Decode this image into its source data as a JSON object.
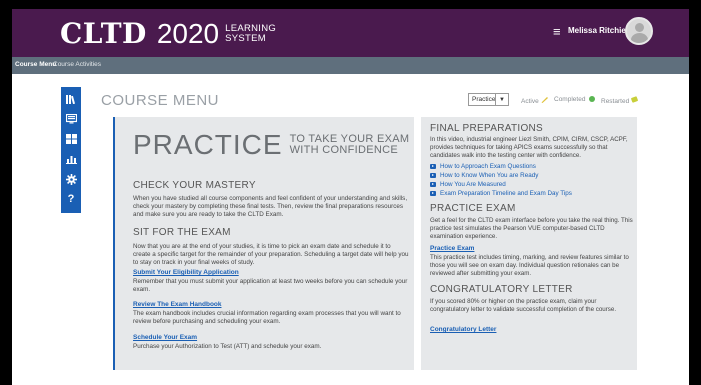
{
  "header": {
    "brand_main": "CLTD",
    "brand_year": "2020",
    "brand_sub_1": "LEARNING",
    "brand_sub_2": "SYSTEM",
    "menu_icon": "hamburger-icon",
    "user_name": "Melissa Ritchie"
  },
  "subnav": {
    "items": [
      "Course Menu",
      "Course Activities"
    ]
  },
  "rail": {
    "icons": [
      "book-icon",
      "monitor-icon",
      "grid-icon",
      "bar-chart-icon",
      "gear-icon",
      "help-icon"
    ],
    "help_glyph": "?"
  },
  "toolbar": {
    "title": "COURSE MENU",
    "view_selected": "Practice",
    "legend": {
      "active": "Active",
      "completed": "Completed",
      "restarted": "Restarted"
    }
  },
  "colors": {
    "header_bg": "#4a1a4e",
    "accent": "#1a5fb4",
    "active": "#e0c23a",
    "completed": "#5ab552",
    "restarted": "#c8cf3a"
  },
  "left_panel": {
    "headline": "PRACTICE",
    "tagline_1": "TO TAKE YOUR EXAM",
    "tagline_2": "WITH CONFIDENCE",
    "check_title": "CHECK YOUR MASTERY",
    "check_text": "When you have studied all course components and feel confident of your understanding and skills, check your mastery by completing these final tests. Then, review the final preparations resources and make sure you are ready to take the CLTD Exam.",
    "sit_title": "SIT FOR THE EXAM",
    "sit_text": "Now that you are at the end of your studies, it is time to pick an exam date and schedule it to create a specific target for the remainder of your preparation. Scheduling a target date will help you to stay on track in your final weeks of study.",
    "link_eligibility": "Submit Your Eligibility Application",
    "eligibility_text": "Remember that you must submit your application at least two weeks before you can schedule your exam.",
    "link_handbook": "Review The Exam Handbook",
    "handbook_text": "The exam handbook includes crucial information regarding exam processes that you will want to review before purchasing and scheduling your exam.",
    "link_schedule": "Schedule Your Exam",
    "schedule_text": "Purchase your Authorization to Test (ATT) and schedule your exam."
  },
  "right_panel": {
    "final_title": "FINAL PREPARATIONS",
    "final_text": "In this video, industrial engineer Liezl Smith, CPIM, CIRM, CSCP, ACPF, provides techniques for taking APICS exams successfully so that candidates walk into the testing center with confidence.",
    "videos": [
      "How to Approach Exam Questions",
      "How to Know When You are Ready",
      "How You Are Measured",
      "Exam Preparation Timeline and Exam Day Tips"
    ],
    "practice_title": "PRACTICE EXAM",
    "practice_text": "Get a feel for the CLTD exam interface before you take the real thing. This practice test simulates the Pearson VUE computer-based CLTD examination experience.",
    "link_practice": "Practice Exam",
    "practice_desc": "This practice test includes timing, marking, and review features similar to those you will see on exam day. Individual question retionales can be reviewed after submitting your exam.",
    "congrats_title": "CONGRATULATORY LETTER",
    "congrats_text": "If you scored 80% or higher on the practice exam, claim your congratulatory letter to validate successful completion of the course.",
    "link_congrats": "Congratulatory Letter"
  }
}
